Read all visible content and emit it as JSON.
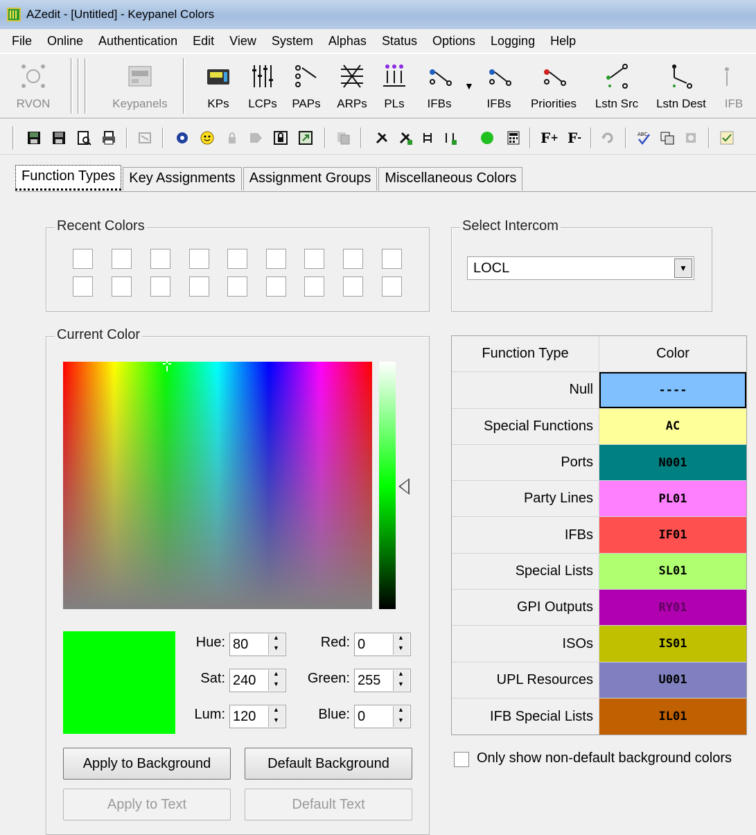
{
  "window": {
    "title": "AZedit - [Untitled] - Keypanel Colors"
  },
  "menu": [
    "File",
    "Online",
    "Authentication",
    "Edit",
    "View",
    "System",
    "Alphas",
    "Status",
    "Options",
    "Logging",
    "Help"
  ],
  "toolbar": {
    "buttons": [
      {
        "label": "RVON",
        "icon": "rvon-network-icon",
        "enabled": false
      },
      {
        "label": "Keypanels",
        "icon": "keypanels-icon",
        "enabled": false
      },
      {
        "label": "KPs",
        "icon": "keypanel-icon",
        "enabled": true
      },
      {
        "label": "LCPs",
        "icon": "lcps-icon",
        "enabled": true
      },
      {
        "label": "PAPs",
        "icon": "paps-icon",
        "enabled": true
      },
      {
        "label": "ARPs",
        "icon": "arps-icon",
        "enabled": true
      },
      {
        "label": "PLs",
        "icon": "party-lines-icon",
        "enabled": true
      },
      {
        "label": "IFBs",
        "icon": "ifbs-icon",
        "enabled": true
      },
      {
        "label": "IFBs",
        "icon": "ifbs-2-icon",
        "enabled": true
      },
      {
        "label": "Priorities",
        "icon": "priorities-icon",
        "enabled": true
      },
      {
        "label": "Lstn Src",
        "icon": "listen-source-icon",
        "enabled": true
      },
      {
        "label": "Lstn Dest",
        "icon": "listen-dest-icon",
        "enabled": true
      },
      {
        "label": "IFB",
        "icon": "ifb-partial-icon",
        "enabled": false
      }
    ]
  },
  "tabs": [
    "Function Types",
    "Key Assignments",
    "Assignment Groups",
    "Miscellaneous Colors"
  ],
  "recent_colors": {
    "title": "Recent Colors"
  },
  "select_intercom": {
    "title": "Select Intercom",
    "value": "LOCL"
  },
  "current_color": {
    "title": "Current Color",
    "swatch_color": "#00ff00",
    "fields": {
      "hue_label": "Hue:",
      "hue": "80",
      "sat_label": "Sat:",
      "sat": "240",
      "lum_label": "Lum:",
      "lum": "120",
      "red_label": "Red:",
      "red": "0",
      "green_label": "Green:",
      "green": "255",
      "blue_label": "Blue:",
      "blue": "0"
    },
    "buttons": {
      "apply_background": "Apply to Background",
      "default_background": "Default Background",
      "apply_text": "Apply to Text",
      "default_text": "Default Text"
    }
  },
  "function_table": {
    "headers": [
      "Function Type",
      "Color"
    ],
    "rows": [
      {
        "type": "Null",
        "code": "----",
        "bg": "#80c0ff",
        "fg": "#000000"
      },
      {
        "type": "Special Functions",
        "code": "AC",
        "bg": "#ffff99",
        "fg": "#000000"
      },
      {
        "type": "Ports",
        "code": "N001",
        "bg": "#008080",
        "fg": "#000000"
      },
      {
        "type": "Party Lines",
        "code": "PL01",
        "bg": "#ff80ff",
        "fg": "#000000"
      },
      {
        "type": "IFBs",
        "code": "IF01",
        "bg": "#ff5050",
        "fg": "#000000"
      },
      {
        "type": "Special Lists",
        "code": "SL01",
        "bg": "#b0ff70",
        "fg": "#000000"
      },
      {
        "type": "GPI Outputs",
        "code": "RY01",
        "bg": "#b000b0",
        "fg": "#600060"
      },
      {
        "type": "ISOs",
        "code": "IS01",
        "bg": "#c0c000",
        "fg": "#000000"
      },
      {
        "type": "UPL Resources",
        "code": "U001",
        "bg": "#8080c0",
        "fg": "#000000"
      },
      {
        "type": "IFB Special Lists",
        "code": "IL01",
        "bg": "#c06000",
        "fg": "#000000"
      }
    ]
  },
  "options": {
    "non_default_only": "Only show non-default background colors"
  }
}
